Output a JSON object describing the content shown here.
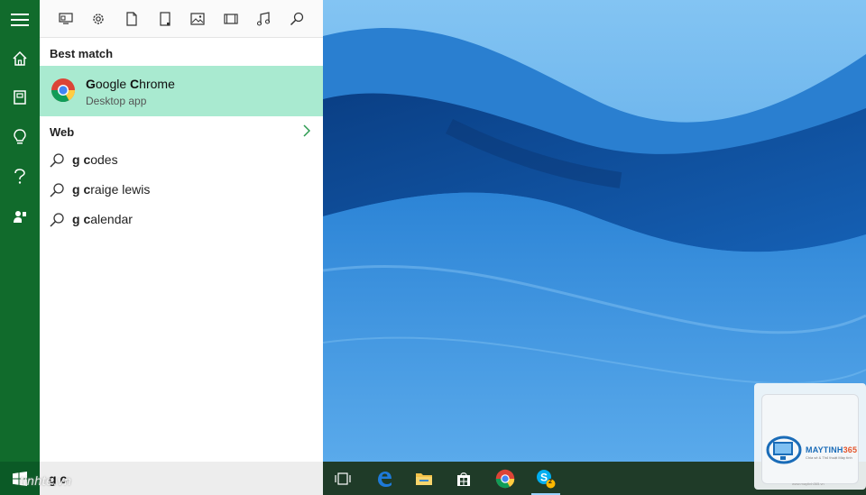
{
  "filters": {
    "icons": [
      "apps-icon",
      "settings-icon",
      "documents-icon",
      "folders-icon",
      "photos-icon",
      "videos-icon",
      "music-icon",
      "web-search-icon"
    ]
  },
  "rail": {
    "icons": [
      "hamburger-menu-icon",
      "home-icon",
      "notebook-icon",
      "lightbulb-icon",
      "help-icon",
      "feedback-icon"
    ]
  },
  "best_match": {
    "label": "Best match",
    "app_title_bold": "G",
    "app_title_rest1": "oogle ",
    "app_title_bold2": "C",
    "app_title_rest2": "hrome",
    "app_subtitle": "Desktop app"
  },
  "web": {
    "label": "Web",
    "suggestions": [
      {
        "bold": "g c",
        "rest": "odes"
      },
      {
        "bold": "g c",
        "rest": "raige lewis"
      },
      {
        "bold": "g c",
        "rest": "alendar"
      }
    ]
  },
  "search": {
    "query": "g c",
    "watermark": "tinhte.vn"
  },
  "taskbar": {
    "icons": [
      "task-view-icon",
      "edge-icon",
      "file-explorer-icon",
      "store-icon",
      "chrome-icon",
      "skype-icon"
    ],
    "skype_badge": "2"
  },
  "logo": {
    "name_part1": "MAYTINH",
    "name_part2": "365",
    "tagline": "Chia sẻ & Thủ thuật Máy tính",
    "url": "www.maytinh365.vn"
  },
  "colors": {
    "rail": "#116b2c",
    "best_match_bg": "#a9ead0",
    "taskbar": "#1f3b28"
  }
}
